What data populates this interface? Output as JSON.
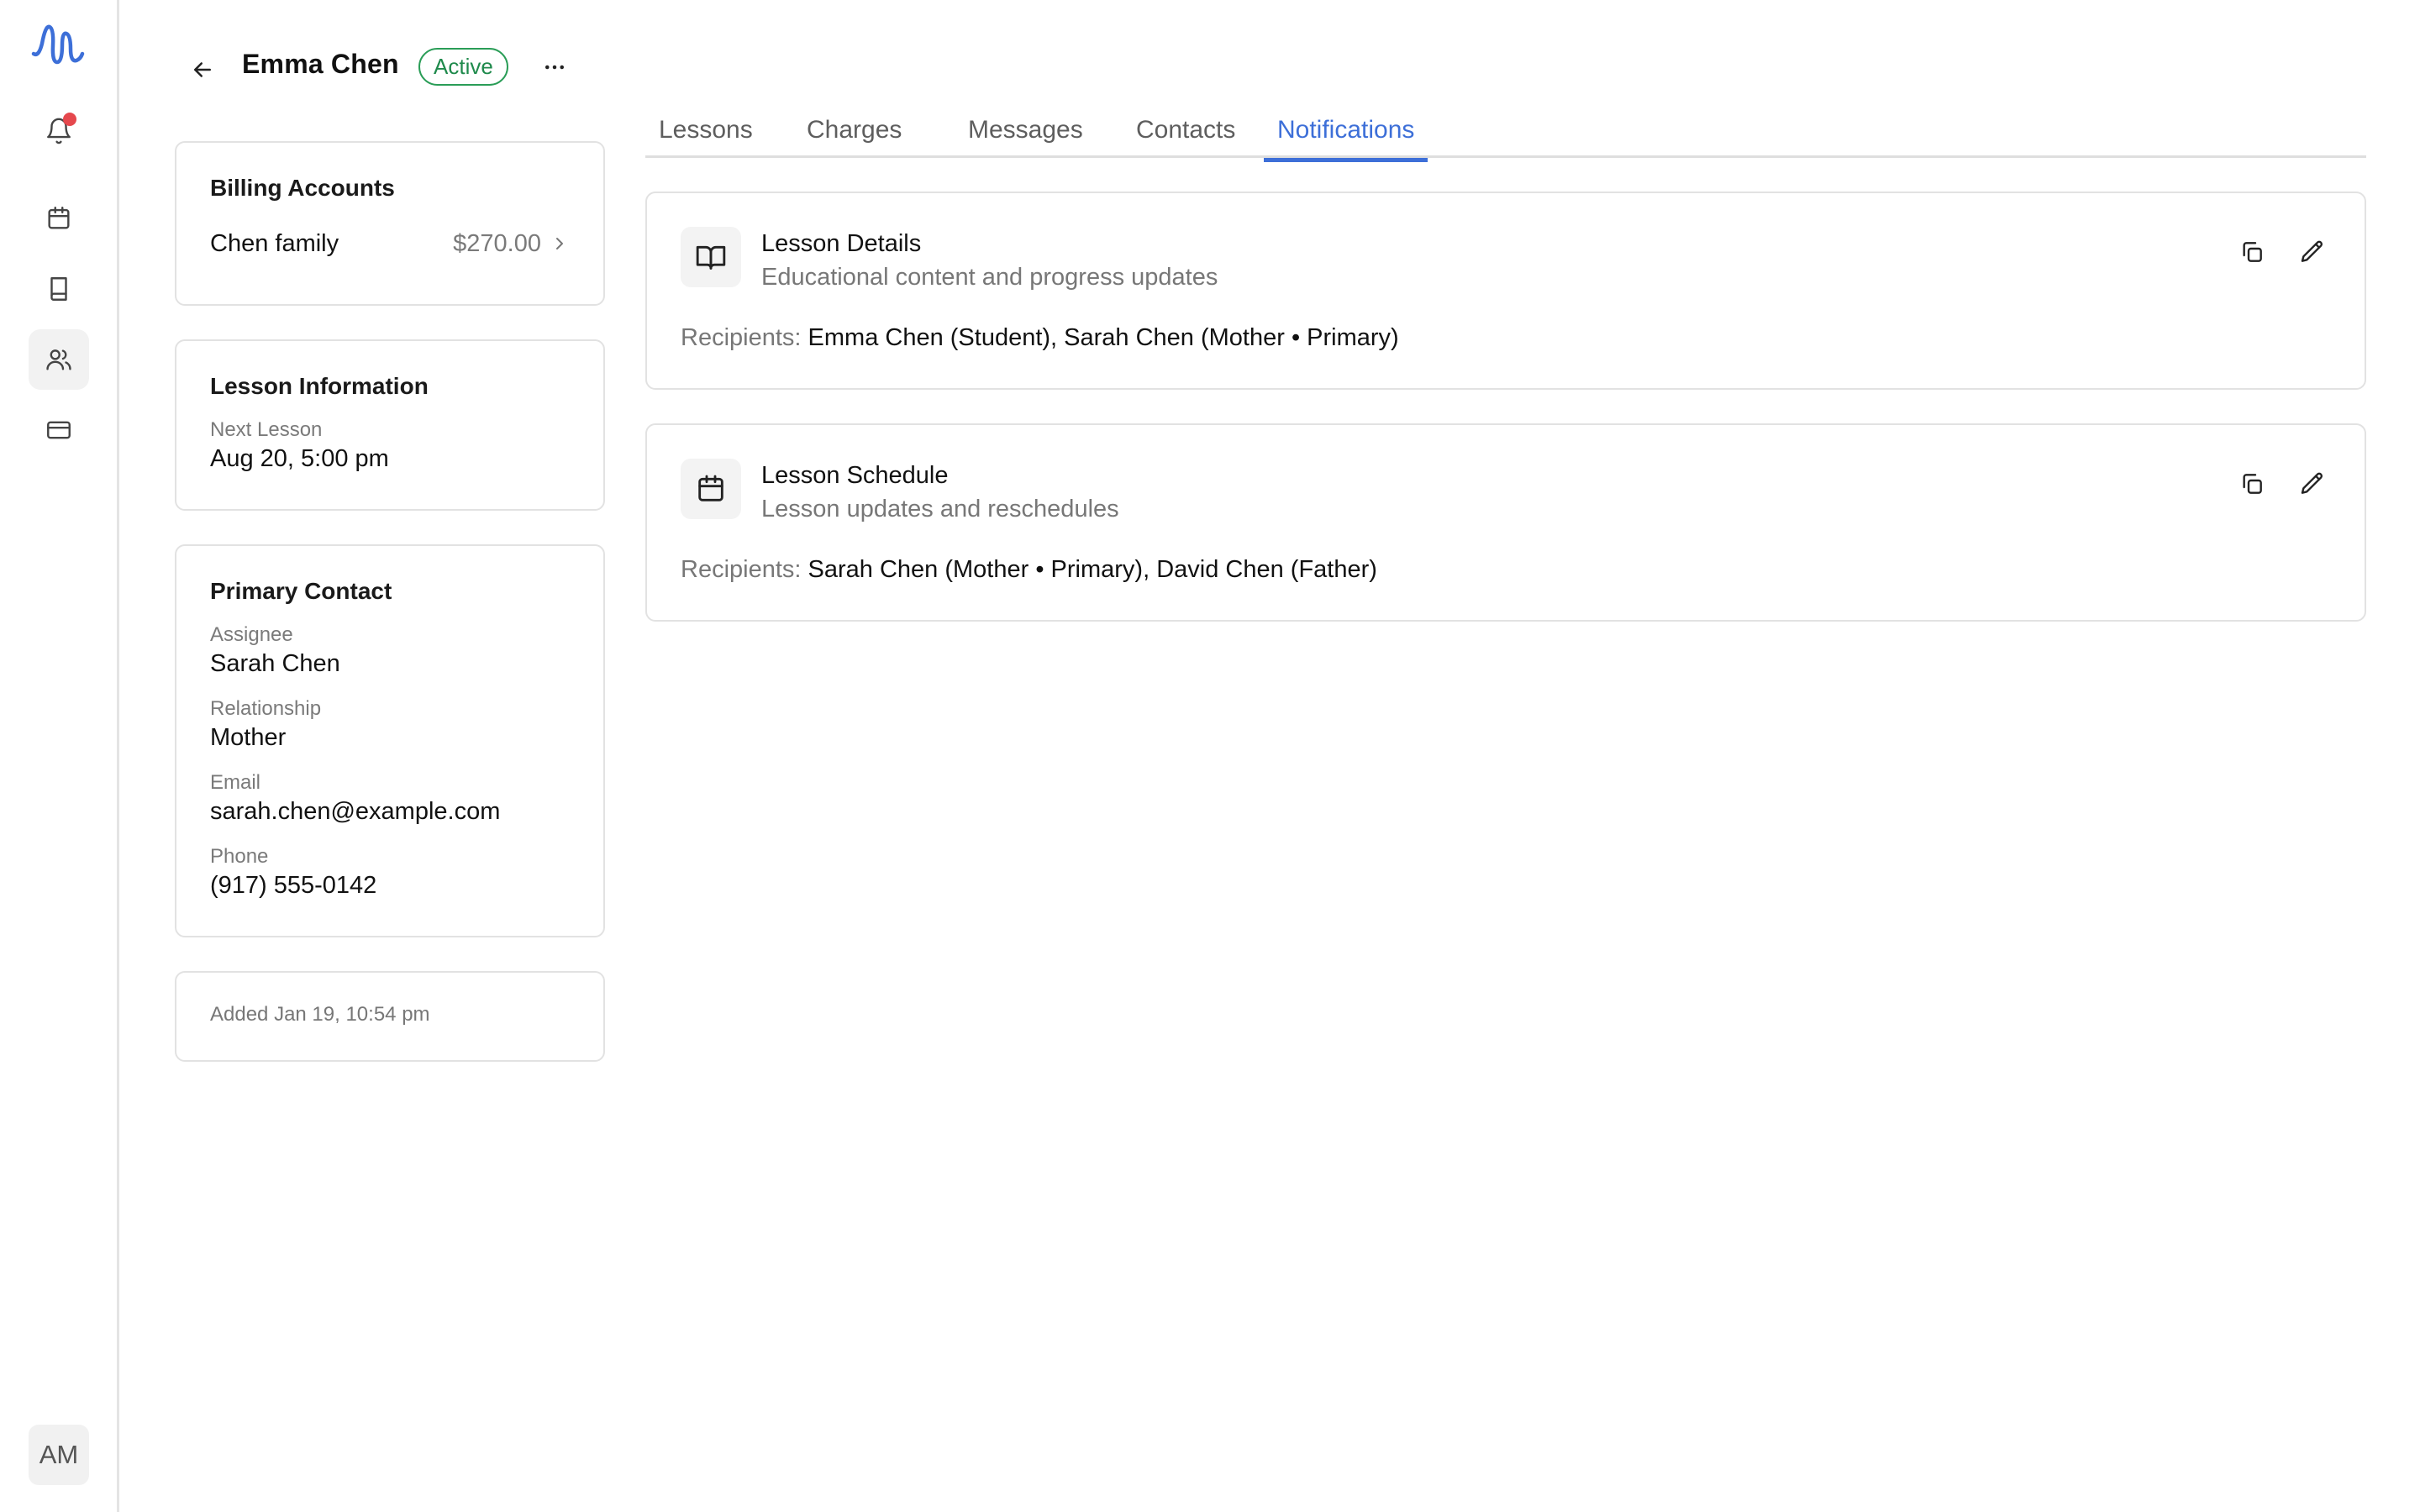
{
  "sidebar": {
    "logo": "waveform-logo",
    "items": [
      {
        "icon": "bell-icon",
        "has_notification": true
      },
      {
        "icon": "calendar-icon"
      },
      {
        "icon": "book-icon"
      },
      {
        "icon": "users-icon",
        "active": true
      },
      {
        "icon": "credit-card-icon"
      }
    ],
    "avatar_initials": "AM"
  },
  "header": {
    "name": "Emma Chen",
    "status": "Active",
    "status_color": "#1f8a4c"
  },
  "billing": {
    "title": "Billing Accounts",
    "accounts": [
      {
        "name": "Chen family",
        "amount": "$270.00"
      }
    ]
  },
  "lesson_info": {
    "title": "Lesson Information",
    "next_label": "Next Lesson",
    "next_value": "Aug 20, 5:00 pm"
  },
  "primary_contact": {
    "title": "Primary Contact",
    "fields": [
      {
        "label": "Assignee",
        "value": "Sarah Chen"
      },
      {
        "label": "Relationship",
        "value": "Mother"
      },
      {
        "label": "Email",
        "value": "sarah.chen@example.com"
      },
      {
        "label": "Phone",
        "value": "(917) 555-0142"
      }
    ]
  },
  "added": "Added Jan 19, 10:54 pm",
  "tabs": [
    {
      "label": "Lessons"
    },
    {
      "label": "Charges"
    },
    {
      "label": "Messages"
    },
    {
      "label": "Contacts"
    },
    {
      "label": "Notifications",
      "active": true
    }
  ],
  "accent_color": "#3d6fd8",
  "notifications": [
    {
      "icon": "open-book-icon",
      "title": "Lesson Details",
      "subtitle": "Educational content and progress updates",
      "recipients_label": "Recipients:",
      "recipients": "Emma Chen (Student), Sarah Chen (Mother • Primary)"
    },
    {
      "icon": "calendar-icon",
      "title": "Lesson Schedule",
      "subtitle": "Lesson updates and reschedules",
      "recipients_label": "Recipients:",
      "recipients": "Sarah Chen (Mother • Primary), David Chen (Father)"
    }
  ]
}
